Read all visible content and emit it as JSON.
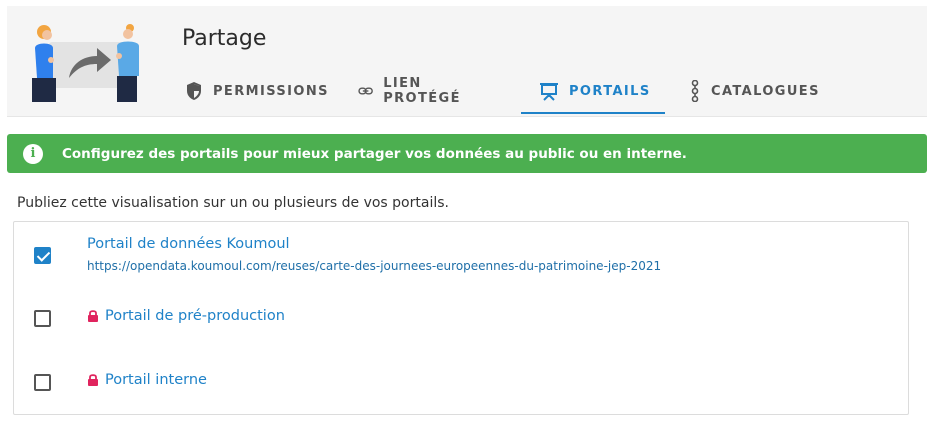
{
  "header": {
    "title": "Partage",
    "tabs": [
      {
        "label": "PERMISSIONS",
        "icon": "shield-icon",
        "active": false
      },
      {
        "label": "LIEN PROTÉGÉ",
        "icon": "link-icon",
        "active": false
      },
      {
        "label": "PORTAILS",
        "icon": "presentation-board-icon",
        "active": true
      },
      {
        "label": "CATALOGUES",
        "icon": "chain-dots-icon",
        "active": false
      }
    ]
  },
  "alert": {
    "icon": "info-icon",
    "text": "Configurez des portails pour mieux partager vos données au public ou en interne."
  },
  "intro": "Publiez cette visualisation sur un ou plusieurs de vos portails.",
  "portals": [
    {
      "name": "Portail de données Koumoul",
      "url": "https://opendata.koumoul.com/reuses/carte-des-journees-europeennes-du-patrimoine-jep-2021",
      "checked": true,
      "locked": false
    },
    {
      "name": "Portail de pré-production",
      "checked": false,
      "locked": true
    },
    {
      "name": "Portail interne",
      "checked": false,
      "locked": true
    }
  ],
  "colors": {
    "accent": "#1f82c8",
    "success": "#4caf50",
    "lock": "#e0245e"
  }
}
